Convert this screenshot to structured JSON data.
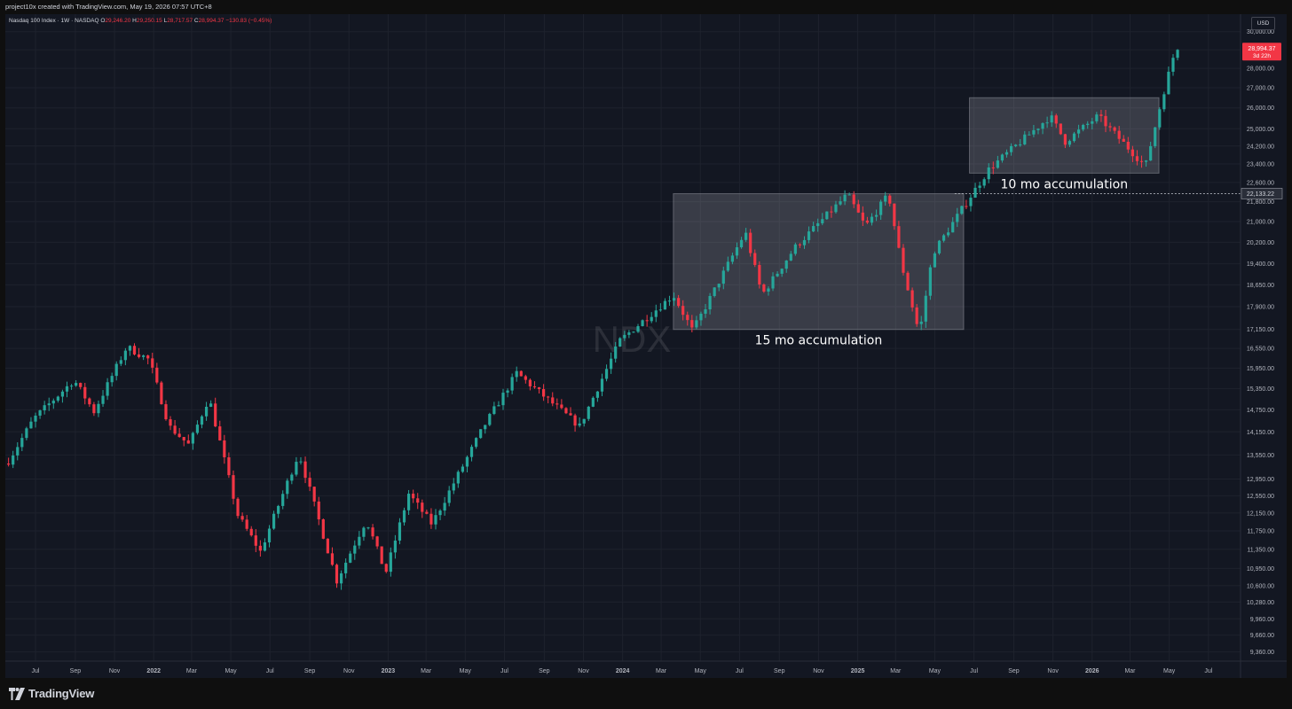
{
  "header": {
    "credit": "project10x created with TradingView.com, May 19, 2026 07:57 UTC+8"
  },
  "legend": {
    "symbol": "Nasdaq 100 Index · 1W · NASDAQ",
    "open_label": "O",
    "open": "29,246.20",
    "high_label": "H",
    "high": "29,250.15",
    "low_label": "L",
    "low": "28,717.57",
    "close_label": "C",
    "close": "28,994.37",
    "change": "−130.83 (−0.45%)"
  },
  "currency": "USD",
  "footer": {
    "brand": "TradingView"
  },
  "colors": {
    "up": "#26a69a",
    "down": "#f23645",
    "background": "#131722",
    "grid": "#1e222d",
    "axis_text": "#b2b5be",
    "box_fill": "#d1d4dc"
  },
  "chart_data": {
    "type": "candlestick",
    "title": "",
    "xlabel": "",
    "ylabel": "",
    "y_axis": {
      "ticks": [
        9360,
        9660,
        9960,
        10280,
        10600,
        10950,
        11350,
        11750,
        12150,
        12550,
        12950,
        13550,
        14150,
        14750,
        15350,
        15950,
        16550,
        17150,
        17900,
        18650,
        19400,
        20200,
        21000,
        21800,
        22600,
        23400,
        24200,
        25000,
        26000,
        27000,
        28000,
        29000,
        30000
      ],
      "tick_labels": [
        "9,360.00",
        "9,660.00",
        "9,960.00",
        "10,280.00",
        "10,600.00",
        "10,950.00",
        "11,350.00",
        "11,750.00",
        "12,150.00",
        "12,550.00",
        "12,950.00",
        "13,550.00",
        "14,150.00",
        "14,750.00",
        "15,350.00",
        "15,950.00",
        "16,550.00",
        "17,150.00",
        "17,900.00",
        "18,650.00",
        "19,400.00",
        "20,200.00",
        "21,000.00",
        "21,800.00",
        "22,600.00",
        "23,400.00",
        "24,200.00",
        "25,000.00",
        "26,000.00",
        "27,000.00",
        "28,000.00",
        "29,000.00",
        "30,000.00"
      ],
      "scale": "log",
      "range": [
        9200,
        31000
      ]
    },
    "x_axis": {
      "range": [
        "2021-05-15",
        "2026-08-20"
      ],
      "ticks": [
        {
          "date": "2021-07-01",
          "label": "Jul"
        },
        {
          "date": "2021-09-01",
          "label": "Sep"
        },
        {
          "date": "2021-11-01",
          "label": "Nov"
        },
        {
          "date": "2022-01-01",
          "label": "2022",
          "bold": true
        },
        {
          "date": "2022-03-01",
          "label": "Mar"
        },
        {
          "date": "2022-05-01",
          "label": "May"
        },
        {
          "date": "2022-07-01",
          "label": "Jul"
        },
        {
          "date": "2022-09-01",
          "label": "Sep"
        },
        {
          "date": "2022-11-01",
          "label": "Nov"
        },
        {
          "date": "2023-01-01",
          "label": "2023",
          "bold": true
        },
        {
          "date": "2023-03-01",
          "label": "Mar"
        },
        {
          "date": "2023-05-01",
          "label": "May"
        },
        {
          "date": "2023-07-01",
          "label": "Jul"
        },
        {
          "date": "2023-09-01",
          "label": "Sep"
        },
        {
          "date": "2023-11-01",
          "label": "Nov"
        },
        {
          "date": "2024-01-01",
          "label": "2024",
          "bold": true
        },
        {
          "date": "2024-03-01",
          "label": "Mar"
        },
        {
          "date": "2024-05-01",
          "label": "May"
        },
        {
          "date": "2024-07-01",
          "label": "Jul"
        },
        {
          "date": "2024-09-01",
          "label": "Sep"
        },
        {
          "date": "2024-11-01",
          "label": "Nov"
        },
        {
          "date": "2025-01-01",
          "label": "2025",
          "bold": true
        },
        {
          "date": "2025-03-01",
          "label": "Mar"
        },
        {
          "date": "2025-05-01",
          "label": "May"
        },
        {
          "date": "2025-07-01",
          "label": "Jul"
        },
        {
          "date": "2025-09-01",
          "label": "Sep"
        },
        {
          "date": "2025-11-01",
          "label": "Nov"
        },
        {
          "date": "2026-01-01",
          "label": "2026",
          "bold": true
        },
        {
          "date": "2026-03-01",
          "label": "Mar"
        },
        {
          "date": "2026-05-01",
          "label": "May"
        },
        {
          "date": "2026-07-01",
          "label": "Jul"
        }
      ]
    },
    "grid": true,
    "watermark": "NDX",
    "series": [
      {
        "interval": "1W",
        "anchors": [
          {
            "date": "2021-05-20",
            "value": 13400
          },
          {
            "date": "2021-06-28",
            "value": 14500
          },
          {
            "date": "2021-08-30",
            "value": 15600
          },
          {
            "date": "2021-09-30",
            "value": 14700
          },
          {
            "date": "2021-11-20",
            "value": 16600
          },
          {
            "date": "2021-12-25",
            "value": 16200
          },
          {
            "date": "2022-01-25",
            "value": 14300
          },
          {
            "date": "2022-02-25",
            "value": 13800
          },
          {
            "date": "2022-03-28",
            "value": 15100
          },
          {
            "date": "2022-05-12",
            "value": 12100
          },
          {
            "date": "2022-06-16",
            "value": 11300
          },
          {
            "date": "2022-08-15",
            "value": 13600
          },
          {
            "date": "2022-10-13",
            "value": 10700
          },
          {
            "date": "2022-11-28",
            "value": 12000
          },
          {
            "date": "2022-12-28",
            "value": 10850
          },
          {
            "date": "2023-02-02",
            "value": 12600
          },
          {
            "date": "2023-03-10",
            "value": 11900
          },
          {
            "date": "2023-05-30",
            "value": 14300
          },
          {
            "date": "2023-07-20",
            "value": 15800
          },
          {
            "date": "2023-10-26",
            "value": 14300
          },
          {
            "date": "2023-12-28",
            "value": 16800
          },
          {
            "date": "2024-03-20",
            "value": 18300
          },
          {
            "date": "2024-04-19",
            "value": 17100
          },
          {
            "date": "2024-07-10",
            "value": 20600
          },
          {
            "date": "2024-08-05",
            "value": 18300
          },
          {
            "date": "2024-09-25",
            "value": 20000
          },
          {
            "date": "2024-12-16",
            "value": 22100
          },
          {
            "date": "2025-01-13",
            "value": 20800
          },
          {
            "date": "2025-02-18",
            "value": 22100
          },
          {
            "date": "2025-03-10",
            "value": 19400
          },
          {
            "date": "2025-04-07",
            "value": 17000
          },
          {
            "date": "2025-04-28",
            "value": 19800
          },
          {
            "date": "2025-06-20",
            "value": 21800
          },
          {
            "date": "2025-07-25",
            "value": 23200
          },
          {
            "date": "2025-10-28",
            "value": 25600
          },
          {
            "date": "2025-11-20",
            "value": 24400
          },
          {
            "date": "2026-01-10",
            "value": 25600
          },
          {
            "date": "2026-03-25",
            "value": 23300
          },
          {
            "date": "2026-04-20",
            "value": 26500
          },
          {
            "date": "2026-05-11",
            "value": 29100
          },
          {
            "date": "2026-05-18",
            "value": 28994.37
          }
        ]
      }
    ],
    "annotations": [
      {
        "type": "box",
        "from": "2024-03-20",
        "to": "2025-06-15",
        "low": 17150,
        "high": 22130,
        "label": "15 mo accumulation"
      },
      {
        "type": "box",
        "from": "2025-06-24",
        "to": "2026-04-15",
        "low": 23000,
        "high": 26500,
        "label": "10 mo accumulation"
      }
    ],
    "price_line": {
      "value": 22133.22,
      "label": "22,133.22"
    },
    "last_price": {
      "value": 28994.37,
      "label": "28,994.37",
      "countdown": "3d 22h"
    }
  }
}
